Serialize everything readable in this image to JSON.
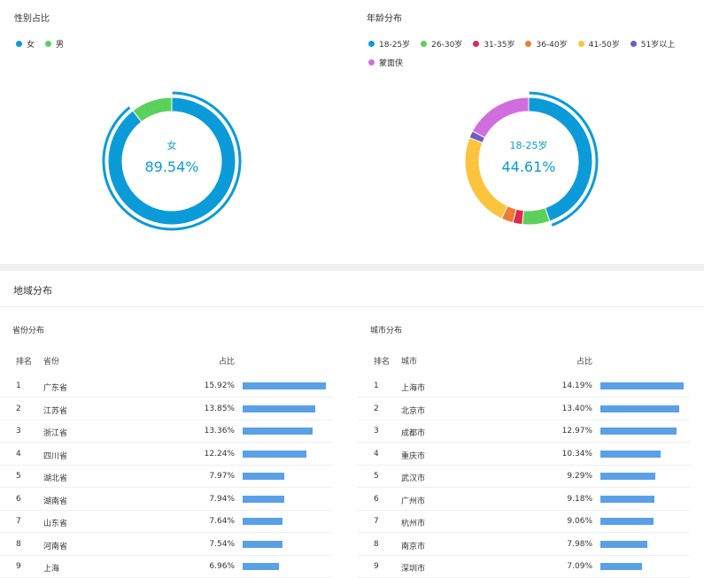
{
  "gender": {
    "title": "性别占比",
    "center_label": "女",
    "center_value": "89.54%",
    "legend": [
      {
        "name": "女",
        "color": "#0b9bd8"
      },
      {
        "name": "男",
        "color": "#5cd05c"
      }
    ]
  },
  "age": {
    "title": "年龄分布",
    "center_label": "18-25岁",
    "center_value": "44.61%",
    "legend": [
      {
        "name": "18-25岁",
        "color": "#0b9bd8"
      },
      {
        "name": "26-30岁",
        "color": "#5cd05c"
      },
      {
        "name": "31-35岁",
        "color": "#e0294f"
      },
      {
        "name": "36-40岁",
        "color": "#f07b32"
      },
      {
        "name": "41-50岁",
        "color": "#fbc43c"
      },
      {
        "name": "51岁以上",
        "color": "#6b5cc8"
      },
      {
        "name": "蒙面侠",
        "color": "#d06ee0"
      }
    ]
  },
  "region": {
    "title": "地域分布",
    "province": {
      "title": "省份分布",
      "headers": {
        "rank": "排名",
        "name": "省份",
        "pct": "占比"
      },
      "rows": [
        {
          "rank": "1",
          "name": "广东省",
          "pct": "15.92%"
        },
        {
          "rank": "2",
          "name": "江苏省",
          "pct": "13.85%"
        },
        {
          "rank": "3",
          "name": "浙江省",
          "pct": "13.36%"
        },
        {
          "rank": "4",
          "name": "四川省",
          "pct": "12.24%"
        },
        {
          "rank": "5",
          "name": "湖北省",
          "pct": "7.97%"
        },
        {
          "rank": "6",
          "name": "湖南省",
          "pct": "7.94%"
        },
        {
          "rank": "7",
          "name": "山东省",
          "pct": "7.64%"
        },
        {
          "rank": "8",
          "name": "河南省",
          "pct": "7.54%"
        },
        {
          "rank": "9",
          "name": "上海",
          "pct": "6.96%"
        }
      ]
    },
    "city": {
      "title": "城市分布",
      "headers": {
        "rank": "排名",
        "name": "城市",
        "pct": "占比"
      },
      "rows": [
        {
          "rank": "1",
          "name": "上海市",
          "pct": "14.19%"
        },
        {
          "rank": "2",
          "name": "北京市",
          "pct": "13.40%"
        },
        {
          "rank": "3",
          "name": "成都市",
          "pct": "12.97%"
        },
        {
          "rank": "4",
          "name": "重庆市",
          "pct": "10.34%"
        },
        {
          "rank": "5",
          "name": "武汉市",
          "pct": "9.29%"
        },
        {
          "rank": "6",
          "name": "广州市",
          "pct": "9.18%"
        },
        {
          "rank": "7",
          "name": "杭州市",
          "pct": "9.06%"
        },
        {
          "rank": "8",
          "name": "南京市",
          "pct": "7.98%"
        },
        {
          "rank": "9",
          "name": "深圳市",
          "pct": "7.09%"
        }
      ]
    }
  },
  "chart_data": [
    {
      "type": "pie",
      "title": "性别占比",
      "categories": [
        "女",
        "男"
      ],
      "values": [
        89.54,
        10.46
      ],
      "colors": [
        "#0b9bd8",
        "#5cd05c"
      ],
      "highlight": "女",
      "legend_position": "top-left"
    },
    {
      "type": "pie",
      "title": "年龄分布",
      "categories": [
        "18-25岁",
        "26-30岁",
        "31-35岁",
        "36-40岁",
        "41-50岁",
        "51岁以上",
        "蒙面侠"
      ],
      "values": [
        44.61,
        7.0,
        2.4,
        3.0,
        24.0,
        1.8,
        17.19
      ],
      "colors": [
        "#0b9bd8",
        "#5cd05c",
        "#e0294f",
        "#f07b32",
        "#fbc43c",
        "#6b5cc8",
        "#d06ee0"
      ],
      "highlight": "18-25岁",
      "legend_position": "top-left"
    },
    {
      "type": "bar",
      "title": "省份分布",
      "categories": [
        "广东省",
        "江苏省",
        "浙江省",
        "四川省",
        "湖北省",
        "湖南省",
        "山东省",
        "河南省",
        "上海"
      ],
      "values": [
        15.92,
        13.85,
        13.36,
        12.24,
        7.97,
        7.94,
        7.64,
        7.54,
        6.96
      ],
      "orientation": "horizontal"
    },
    {
      "type": "bar",
      "title": "城市分布",
      "categories": [
        "上海市",
        "北京市",
        "成都市",
        "重庆市",
        "武汉市",
        "广州市",
        "杭州市",
        "南京市",
        "深圳市"
      ],
      "values": [
        14.19,
        13.4,
        12.97,
        10.34,
        9.29,
        9.18,
        9.06,
        7.98,
        7.09
      ],
      "orientation": "horizontal"
    }
  ]
}
